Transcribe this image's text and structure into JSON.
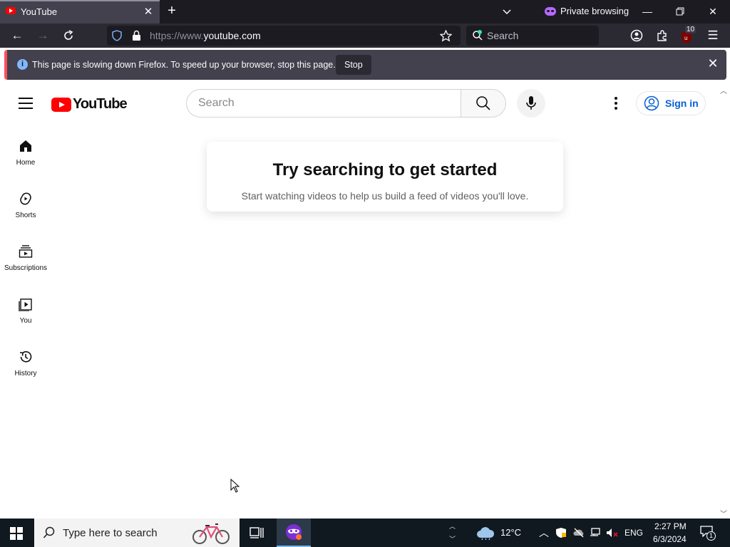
{
  "browser": {
    "tab_title": "YouTube",
    "private_label": "Private browsing",
    "url_prefix": "https://www.",
    "url_domain": "youtube.com",
    "search_placeholder": "Search",
    "badge_count": "10",
    "notification": {
      "message": "This page is slowing down Firefox. To speed up your browser, stop this page.",
      "stop_label": "Stop"
    }
  },
  "youtube": {
    "logo_text": "YouTube",
    "search_placeholder": "Search",
    "sign_in_label": "Sign in",
    "sidebar": [
      {
        "label": "Home",
        "icon": "home-icon"
      },
      {
        "label": "Shorts",
        "icon": "shorts-icon"
      },
      {
        "label": "Subscriptions",
        "icon": "subscriptions-icon"
      },
      {
        "label": "You",
        "icon": "you-icon"
      },
      {
        "label": "History",
        "icon": "history-icon"
      }
    ],
    "empty_state": {
      "heading": "Try searching to get started",
      "subtext": "Start watching videos to help us build a feed of videos you'll love."
    }
  },
  "taskbar": {
    "search_placeholder": "Type here to search",
    "weather": "12°C",
    "language": "ENG",
    "time": "2:27 PM",
    "date": "6/3/2024",
    "notification_count": "1"
  }
}
